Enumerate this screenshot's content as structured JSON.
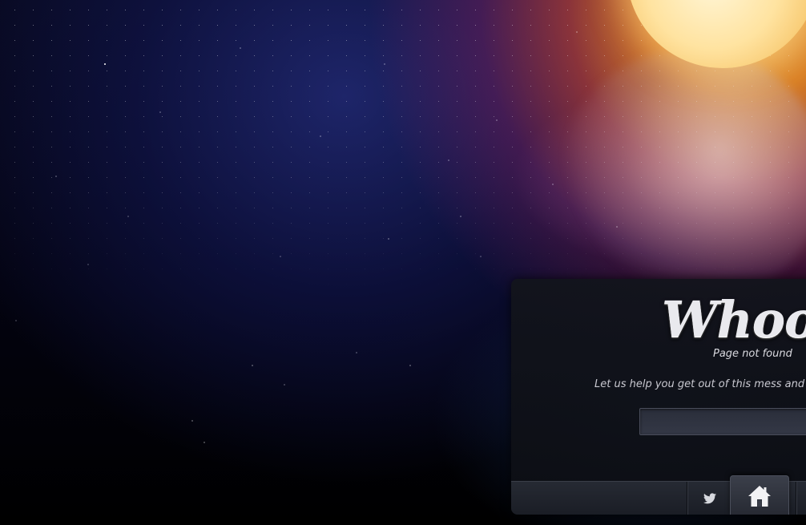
{
  "error_panel": {
    "title": "Whoops",
    "subtitle": "Page not found",
    "help_text": "Let us help you get out of this mess and  find",
    "search": {
      "value": "",
      "placeholder": ""
    }
  },
  "footer": {
    "icons": {
      "twitter": "twitter-bird-icon",
      "home": "house-icon"
    }
  },
  "colors": {
    "panel_background": "#12141c",
    "title_text": "#e9e9ee",
    "moon": "#ffe3a0"
  }
}
